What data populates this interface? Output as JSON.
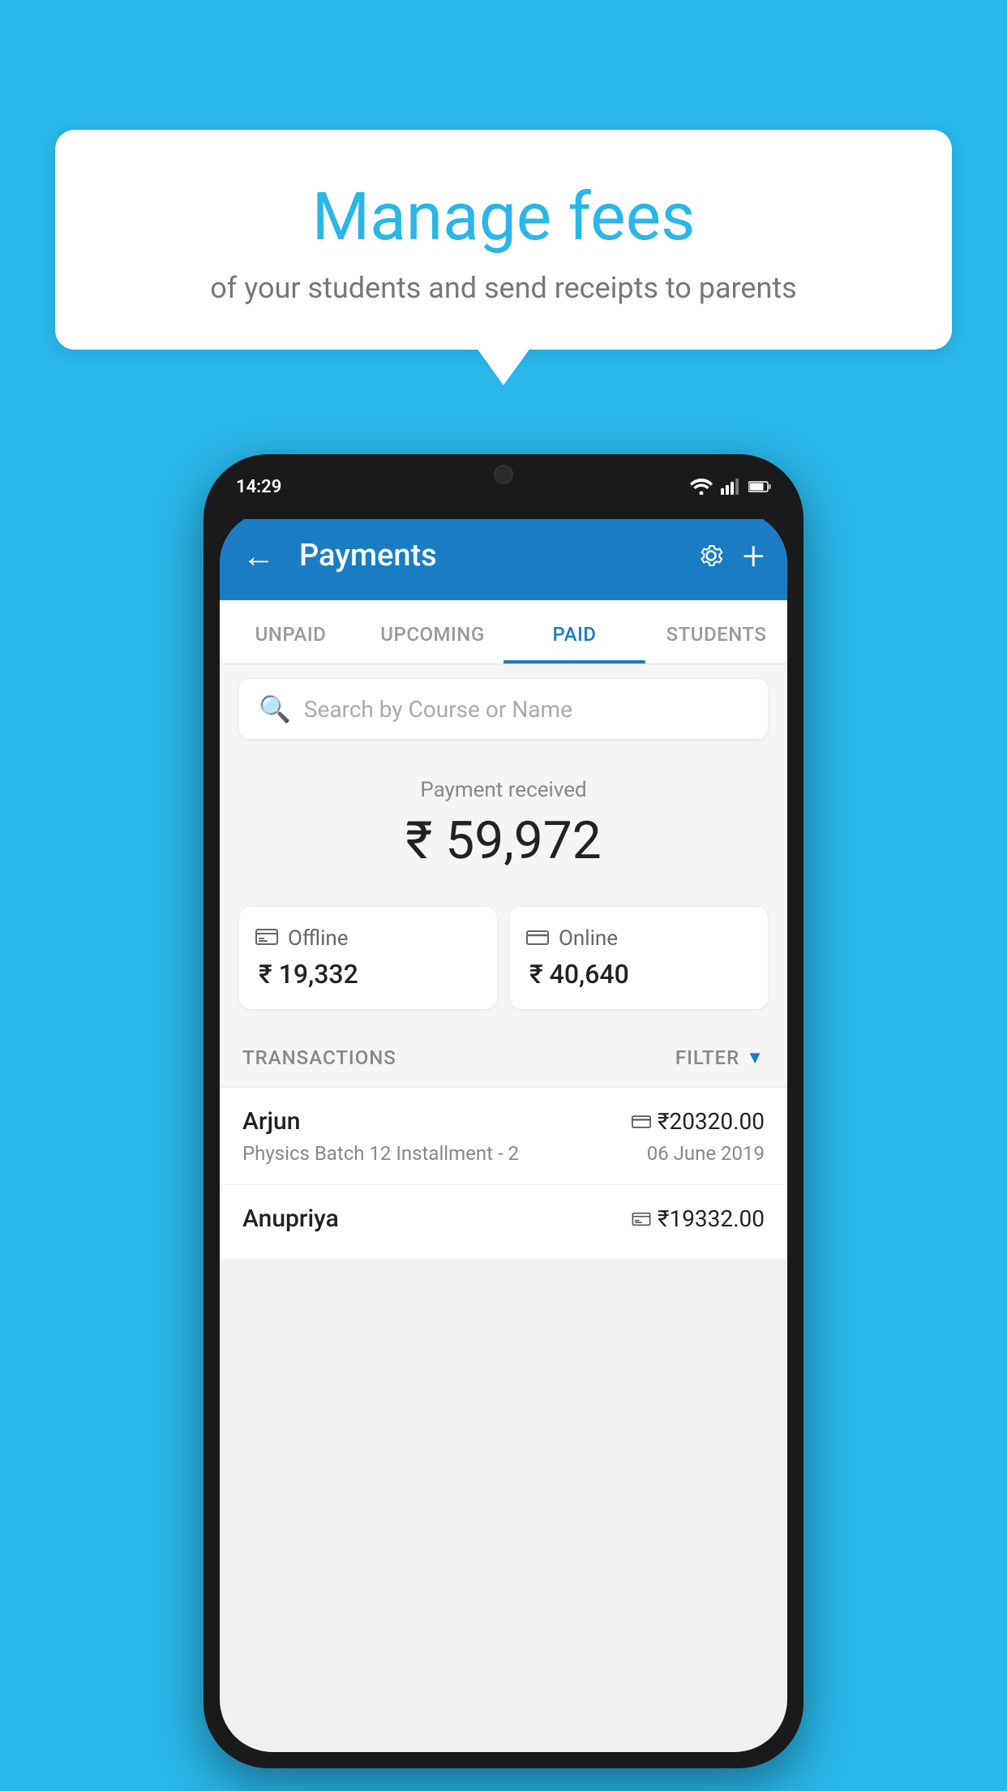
{
  "background_color": "#29b6e8",
  "speech_bubble": {
    "title": "Manage fees",
    "subtitle": "of your students and send receipts to parents"
  },
  "status_bar": {
    "time": "14:29",
    "wifi": "▼",
    "signal": "▲",
    "battery": "▮"
  },
  "app_bar": {
    "title": "Payments",
    "back_label": "←",
    "settings_label": "⚙",
    "add_label": "+"
  },
  "tabs": [
    {
      "label": "UNPAID",
      "active": false
    },
    {
      "label": "UPCOMING",
      "active": false
    },
    {
      "label": "PAID",
      "active": true
    },
    {
      "label": "STUDENTS",
      "active": false
    }
  ],
  "search": {
    "placeholder": "Search by Course or Name"
  },
  "payment_summary": {
    "label": "Payment received",
    "amount": "₹ 59,972",
    "offline": {
      "label": "Offline",
      "amount": "₹ 19,332"
    },
    "online": {
      "label": "Online",
      "amount": "₹ 40,640"
    }
  },
  "transactions": {
    "section_label": "TRANSACTIONS",
    "filter_label": "FILTER",
    "items": [
      {
        "name": "Arjun",
        "amount": "₹20320.00",
        "course": "Physics Batch 12 Installment - 2",
        "date": "06 June 2019",
        "payment_type": "online"
      },
      {
        "name": "Anupriya",
        "amount": "₹19332.00",
        "course": "",
        "date": "",
        "payment_type": "offline"
      }
    ]
  }
}
